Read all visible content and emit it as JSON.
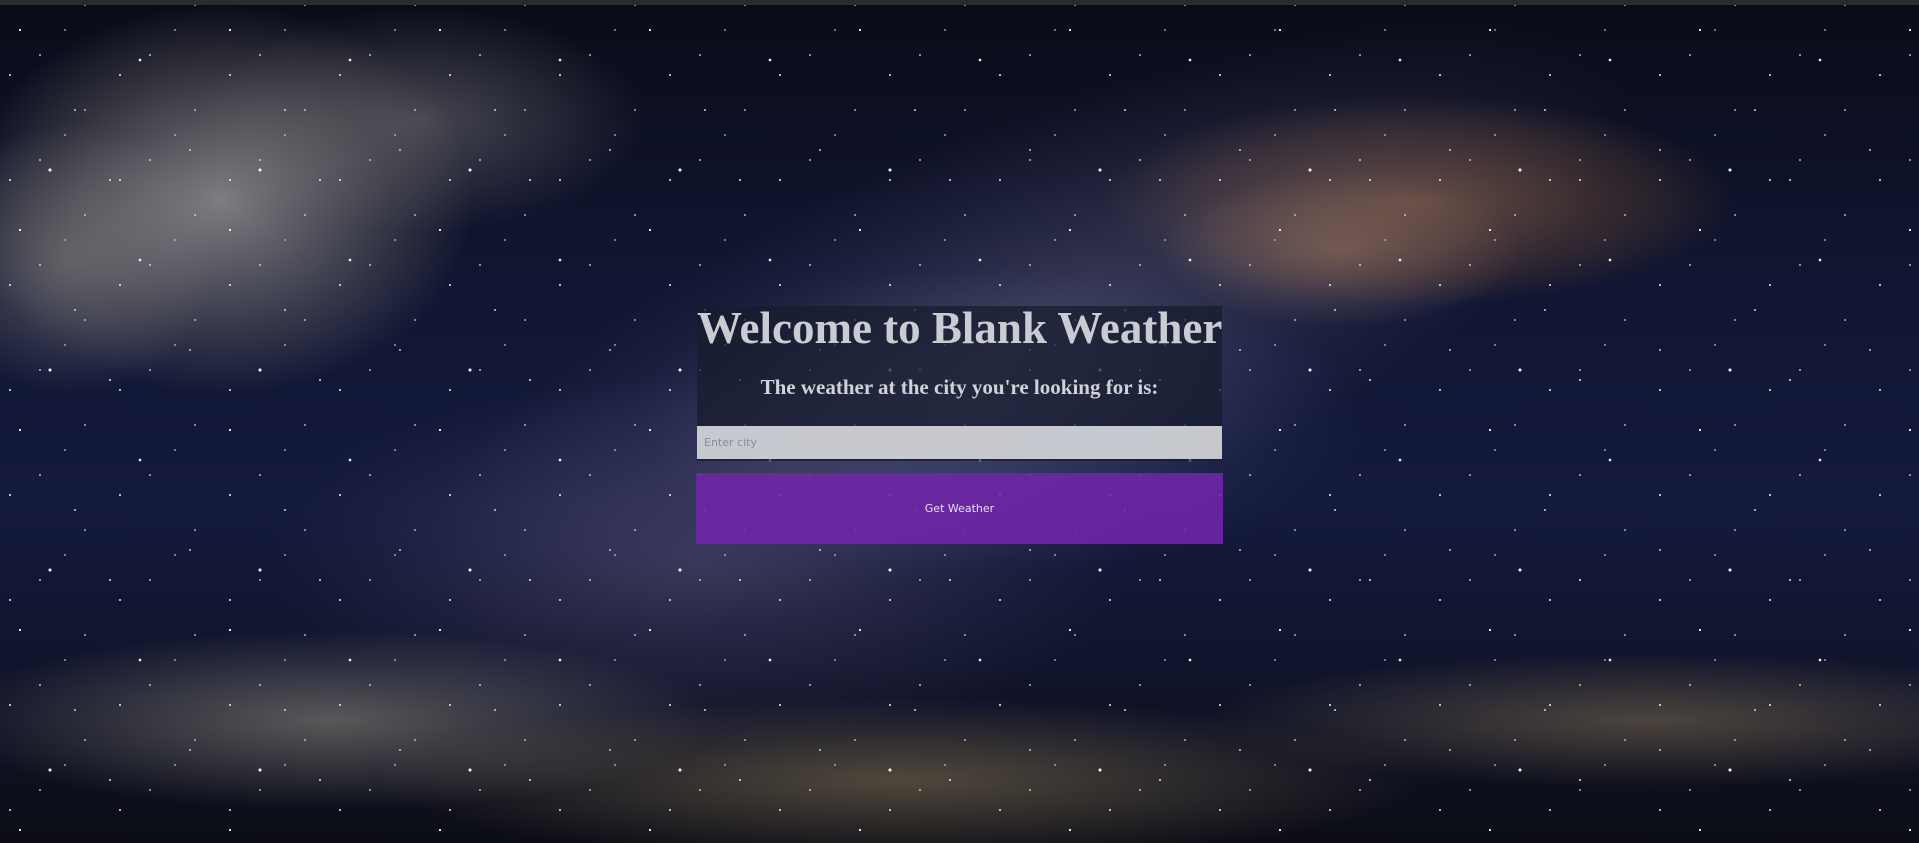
{
  "header": {
    "title": "Welcome to Blank Weather",
    "subtitle": "The weather at the city you're looking for is:"
  },
  "search": {
    "placeholder": "Enter city",
    "value": ""
  },
  "actions": {
    "get_weather_label": "Get Weather"
  },
  "colors": {
    "button": "#7026a8",
    "panel": "#161c2c",
    "input": "#dee0e4",
    "text": "#c9ccd3"
  },
  "background": {
    "icon": "night-sky-milky-way"
  }
}
